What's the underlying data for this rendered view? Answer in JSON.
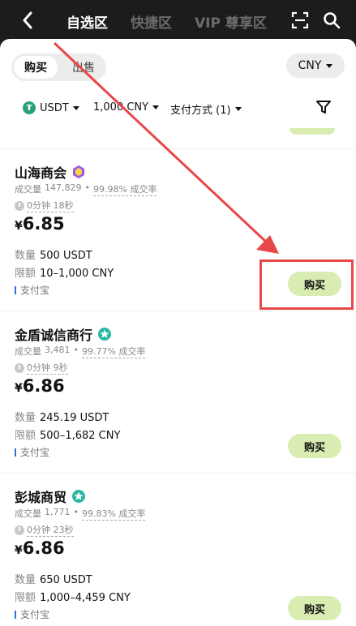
{
  "header": {
    "tabs": [
      {
        "label": "自选区"
      },
      {
        "label": "快捷区"
      },
      {
        "label": "VIP 尊享区"
      }
    ]
  },
  "trade": {
    "buy_label": "购买",
    "sell_label": "出售",
    "currency": "CNY"
  },
  "filters": {
    "asset": "USDT",
    "amount": "1,000 CNY",
    "payment": "支付方式 (1)"
  },
  "merchants": [
    {
      "name": "山海商会",
      "volume_label": "成交量",
      "volume": "147,829",
      "rate": "99.98% 成交率",
      "timer": "0分钟 18秒",
      "currency_symbol": "¥",
      "price": "6.85",
      "qty_label": "数量",
      "qty": "500 USDT",
      "limit_label": "限额",
      "limit": "10–1,000 CNY",
      "payment": "支付宝",
      "button": "购买"
    },
    {
      "name": "金盾诚信商行",
      "volume_label": "成交量",
      "volume": "3,481",
      "rate": "99.77% 成交率",
      "timer": "0分钟 9秒",
      "currency_symbol": "¥",
      "price": "6.86",
      "qty_label": "数量",
      "qty": "245.19 USDT",
      "limit_label": "限额",
      "limit": "500–1,682 CNY",
      "payment": "支付宝",
      "button": "购买"
    },
    {
      "name": "彭城商贸",
      "volume_label": "成交量",
      "volume": "1,771",
      "rate": "99.83% 成交率",
      "timer": "0分钟 23秒",
      "currency_symbol": "¥",
      "price": "6.86",
      "qty_label": "数量",
      "qty": "650 USDT",
      "limit_label": "限额",
      "limit": "1,000–4,459 CNY",
      "payment": "支付宝",
      "button": "购买"
    }
  ],
  "colors": {
    "accent_button": "#d9ecb1",
    "annotation": "#e8474a",
    "usdt": "#26a17b"
  }
}
